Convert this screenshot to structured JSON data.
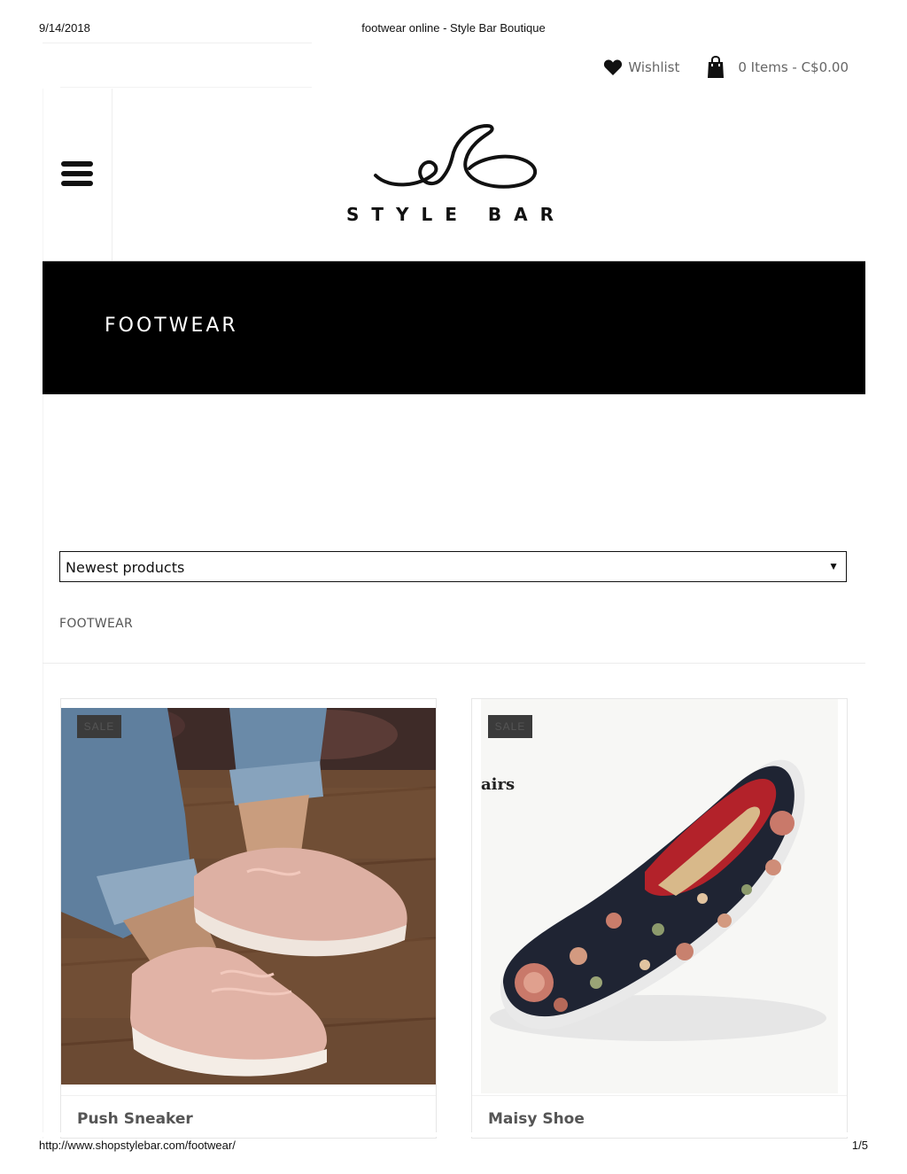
{
  "print_header": {
    "date": "9/14/2018",
    "title": "footwear online - Style Bar Boutique"
  },
  "utility": {
    "wishlist_label": "Wishlist",
    "cart_label": "0 Items - C$0.00"
  },
  "logo": {
    "text": "STYLE BAR"
  },
  "banner": {
    "title": "FOOTWEAR"
  },
  "sort": {
    "selected": "Newest products",
    "arrow": "▼"
  },
  "breadcrumb": "FOOTWEAR",
  "products": [
    {
      "name": "Push Sneaker",
      "badge": "SALE",
      "image_desc": "pink knit sneaker on wood floor"
    },
    {
      "name": "Maisy Shoe",
      "badge": "SALE",
      "image_desc": "navy floral slip-on shoe"
    }
  ],
  "print_footer": {
    "url": "http://www.shopstylebar.com/footwear/",
    "page": "1/5"
  },
  "colors": {
    "banner_bg": "#000000",
    "text_muted": "#666666"
  }
}
